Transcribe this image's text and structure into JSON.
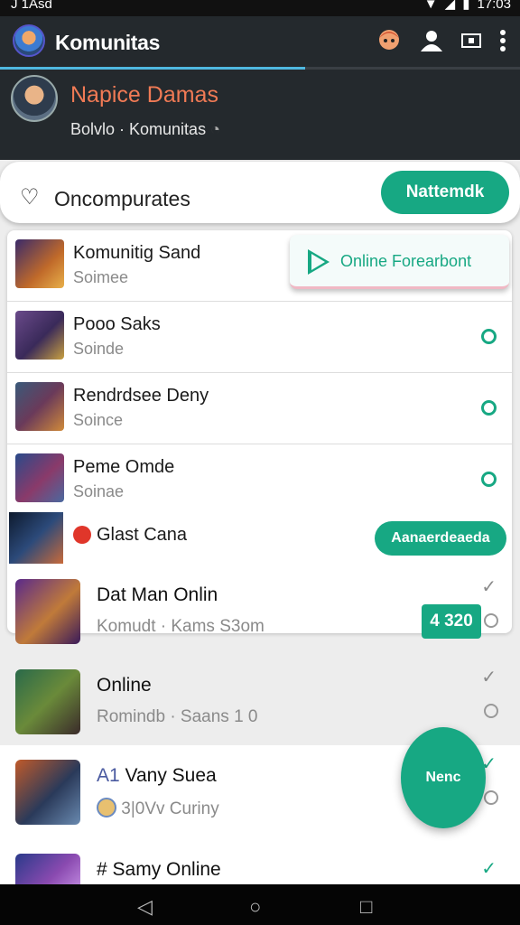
{
  "status": {
    "left": "J 1Asd",
    "time": "17:03"
  },
  "appbar": {
    "title": "Komunitas"
  },
  "profile": {
    "name": "Napice Damas",
    "subtitle": "Bolvlo · Komunitas"
  },
  "search": {
    "label": "Oncompurates",
    "button": "Nattemdk"
  },
  "popover": {
    "label": "Online Forearbont"
  },
  "list1": [
    {
      "title": "Komunitig Sand",
      "subtitle": "Soimee"
    },
    {
      "title": "Pooo Saks",
      "subtitle": "Soinde"
    },
    {
      "title": "Rendrdsee Deny",
      "subtitle": "Soince"
    },
    {
      "title": "Peme Omde",
      "subtitle": "Soinae"
    }
  ],
  "glast": {
    "title": "Glast Cana",
    "button": "Aanaerdeaeda"
  },
  "list2": [
    {
      "title": "Dat Man Onlin",
      "subtitle": "Komudt · Kams S3om"
    },
    {
      "title": "Online",
      "subtitle": "Romindb · Saans 1 0"
    },
    {
      "title": "Vany Suea",
      "prefix": "A1",
      "subtitle": "3|0Vv Curiny"
    },
    {
      "title": "# Samy Online",
      "subtitle": ""
    }
  ],
  "badge": {
    "value": "4 320"
  },
  "fab": {
    "label": "Nenc"
  },
  "colors": {
    "accent": "#17a883",
    "appbar": "#24292d",
    "profile_name": "#f07a55"
  }
}
